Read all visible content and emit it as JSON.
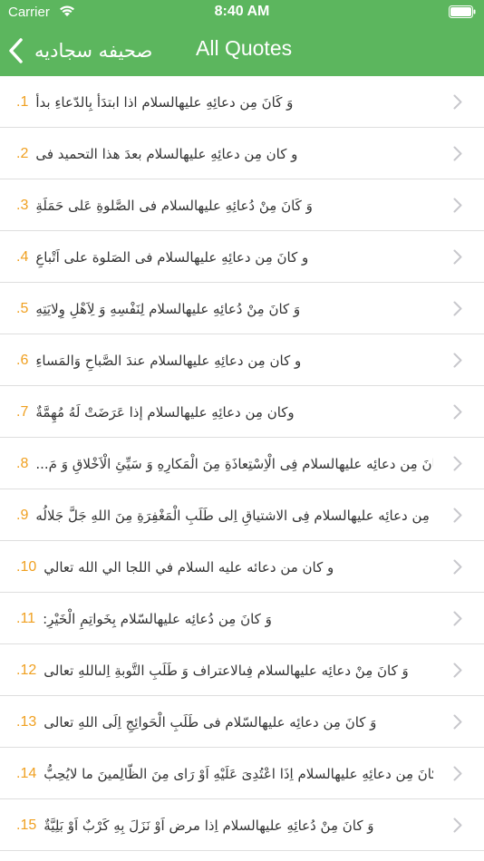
{
  "status_bar": {
    "carrier": "Carrier",
    "time": "8:40 AM"
  },
  "nav": {
    "back_label": "صحیفه سجادیه",
    "title": "All Quotes"
  },
  "colors": {
    "header_bg": "#5cb65e",
    "number": "#f0a020",
    "chevron": "#c7c7cc"
  },
  "quotes": [
    {
      "num": "1.",
      "text": "وَ كَانَ مِن دعائِهِ عليهالسلام اذا ابتدَأ بِالدّعاءِ بدأ"
    },
    {
      "num": "2.",
      "text": "و كان مِن دعائِهِ عليهالسلام بعدَ هذا التحميد فى"
    },
    {
      "num": "3.",
      "text": "وَ كَانَ مِنْ دُعائِهِ عليهالسلام فى الصَّلوةِ عَلى حَمَلَةِ"
    },
    {
      "num": "4.",
      "text": "و كانَ مِن دعائِهِ عليهالسلام فى الصَلوة على اَتْباعِ"
    },
    {
      "num": "5.",
      "text": "وَ كانَ مِنْ دُعائِهِ عليهالسلام لِنَفْسِهِ وَ لِاَهْلِ وِلايَتِهِ"
    },
    {
      "num": "6.",
      "text": "و كان مِن دعائِهِ عليهالسلام عندَ الصَّباحِ وَالمَساءِ"
    },
    {
      "num": "7.",
      "text": "وكان مِن دعائِهِ عليهالسلام إذا عَرَضَتْ لَهُ مُهِمَّةٌ"
    },
    {
      "num": "8.",
      "text": "وَ كانَ مِن دعائِه عليهالسلام فِى الْاِسْتِعاذَةِ مِنَ الْمَكارِهِ وَ سَيِّئِ الْاَخْلاقِ وَ مَ..."
    },
    {
      "num": "9.",
      "text": "وَ كانَ مِن دعائِه عليهالسلام فِى الاشتياقِ اِلى طَلَبِ الْمَغْفِرَةِ مِنَ اللهِ جَلَّ جَلالُه"
    },
    {
      "num": "10.",
      "text": "و كان من دعائه عليه السلام في اللجا الي الله تعالي"
    },
    {
      "num": "11.",
      "text": "وَ كانَ مِن دُعائِه عليهالسّلام بِخَواتِمِ الْخَيْرِ:"
    },
    {
      "num": "12.",
      "text": "وَ كانَ مِنْ دعائِه عليهالسلام فِىالاعتراف وَ طَلَبِ التَّوبةِ اِلىاللهِ تعالى"
    },
    {
      "num": "13.",
      "text": "وَ كانَ مِن دعائِه عليهالسّلام فى طَلَبِ الْحَوائِجِ اِلَى اللهِ تعالى"
    },
    {
      "num": "14.",
      "text": "وَ كانَ مِن دعائِهِ عليهالسلام اِذَا اعْتُدِىَ عَلَيْهِ اَوْ رَاى مِنَ الظّالِمينَ ما لايُحِبُّ"
    },
    {
      "num": "15.",
      "text": "وَ كانَ مِنْ دُعائِهِ عليهالسلام اِذا مرض اَوْ نَزَلَ بِهِ كَرْبٌ اَوْ بَلِيَّةٌ"
    }
  ]
}
